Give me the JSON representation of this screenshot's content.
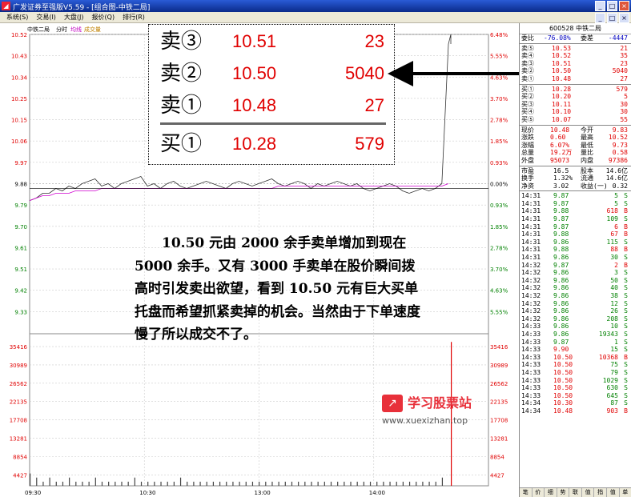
{
  "window": {
    "title": "广发证券至强版V5.59 - [组合图-中铁二局]",
    "icon_glyph": "◢",
    "buttons": [
      "_",
      "□",
      "×"
    ],
    "inner_buttons": [
      "_",
      "□",
      "×"
    ]
  },
  "menu": [
    "系统(S)",
    "交易(I)",
    "大盘(J)",
    "报价(Q)",
    "排行(R)"
  ],
  "chart_header": {
    "name": "中铁二局",
    "tab_minute": "分时",
    "tab_avg": "均线",
    "tab_vol": "成交量"
  },
  "chart_data": {
    "type": "line",
    "price_ticks": [
      "10.52",
      "10.43",
      "10.34",
      "10.25",
      "10.15",
      "10.06",
      "9.97",
      "9.88",
      "9.79",
      "9.70",
      "9.61",
      "9.51",
      "9.42",
      "9.33"
    ],
    "pct_ticks": [
      "6.48%",
      "5.55%",
      "4.63%",
      "3.70%",
      "2.78%",
      "1.85%",
      "0.93%",
      "0.00%",
      "0.93%",
      "1.85%",
      "2.78%",
      "3.70%",
      "4.63%",
      "5.55%"
    ],
    "volume_ticks": [
      "35416",
      "30989",
      "26562",
      "22135",
      "17708",
      "13281",
      "8854",
      "4427"
    ],
    "time_ticks": [
      "09:30",
      "10:30",
      "13:00",
      "14:00"
    ],
    "prev_close": 9.88,
    "ylim": [
      9.28,
      10.52
    ],
    "price_series": [
      9.83,
      9.84,
      9.86,
      9.86,
      9.88,
      9.87,
      9.89,
      9.88,
      9.9,
      9.91,
      9.92,
      9.89,
      9.9,
      9.88,
      9.9,
      9.91,
      9.92,
      9.93,
      9.89,
      9.9,
      9.88,
      9.9,
      9.91,
      9.89,
      9.88,
      9.89,
      9.9,
      9.91,
      9.9,
      9.89,
      9.88,
      9.9,
      9.91,
      9.9,
      9.89,
      9.9,
      9.91,
      9.92,
      9.9,
      9.89,
      9.9,
      9.91,
      9.9,
      9.88,
      9.9,
      9.89,
      9.9,
      9.91,
      9.9,
      9.89,
      9.9,
      9.88,
      9.87,
      9.88,
      9.89,
      9.9,
      9.89,
      9.87,
      9.86,
      9.87,
      9.88,
      9.87,
      9.88,
      9.9,
      10.48
    ],
    "avg_series": [
      9.83,
      9.84,
      9.85,
      9.85,
      9.86,
      9.86,
      9.86,
      9.87,
      9.87,
      9.87,
      9.87,
      9.88,
      9.88,
      9.88,
      9.88,
      9.88,
      9.88,
      9.88,
      9.88,
      9.88,
      9.88,
      9.88,
      9.88,
      9.88,
      9.88,
      9.88,
      9.88,
      9.88,
      9.88,
      9.88,
      9.88,
      9.88,
      9.88,
      9.88,
      9.88,
      9.88,
      9.88,
      9.88,
      9.89,
      9.89,
      9.89,
      9.89,
      9.89,
      9.89,
      9.89,
      9.89,
      9.89,
      9.89,
      9.89,
      9.89,
      9.89,
      9.89,
      9.89,
      9.89,
      9.89,
      9.89,
      9.89,
      9.89,
      9.89,
      9.89,
      9.89,
      9.89,
      9.89,
      9.89,
      9.9
    ],
    "volume_series": [
      3,
      2,
      1,
      2,
      1,
      1,
      2,
      1,
      1,
      1,
      2,
      1,
      1,
      1,
      1,
      1,
      2,
      1,
      1,
      1,
      1,
      1,
      1,
      2,
      1,
      1,
      1,
      1,
      1,
      1,
      1,
      1,
      1,
      1,
      1,
      1,
      1,
      1,
      1,
      1,
      1,
      1,
      1,
      1,
      1,
      1,
      1,
      1,
      1,
      1,
      1,
      1,
      1,
      1,
      1,
      1,
      1,
      1,
      1,
      1,
      1,
      1,
      1,
      2,
      35
    ],
    "volume_max": 37000
  },
  "zoom": {
    "rows": [
      {
        "label": "卖③",
        "price": "10.51",
        "vol": "23"
      },
      {
        "label": "卖②",
        "price": "10.50",
        "vol": "5040"
      },
      {
        "label": "卖①",
        "price": "10.48",
        "vol": "27"
      },
      {
        "label": "买①",
        "price": "10.28",
        "vol": "579"
      }
    ]
  },
  "annotation": {
    "text": "10.50 元由 2000 余手卖单增加到现在 5000 余手。又有 3000 手卖单在股价瞬间拨高时引发卖出欲望，看到 10.50 元有巨大买单托盘而希望抓紧卖掉的机会。当然由于下单速度慢了所以成交不了。"
  },
  "watermark": {
    "logo_glyph": "↗",
    "name": "学习股票站",
    "url": "www.xuexizhan.top"
  },
  "quote": {
    "title": "600528 中铁二局",
    "ratio_row": {
      "l1": "委比",
      "v1": "-76.08%",
      "l2": "委差",
      "v2": "-4447"
    },
    "asks": [
      {
        "label": "卖⑤",
        "price": "10.53",
        "vol": "21"
      },
      {
        "label": "卖④",
        "price": "10.52",
        "vol": "35"
      },
      {
        "label": "卖③",
        "price": "10.51",
        "vol": "23"
      },
      {
        "label": "卖②",
        "price": "10.50",
        "vol": "5040"
      },
      {
        "label": "卖①",
        "price": "10.48",
        "vol": "27"
      }
    ],
    "bids": [
      {
        "label": "买①",
        "price": "10.28",
        "vol": "579"
      },
      {
        "label": "买②",
        "price": "10.20",
        "vol": "5"
      },
      {
        "label": "买③",
        "price": "10.11",
        "vol": "30"
      },
      {
        "label": "买④",
        "price": "10.10",
        "vol": "30"
      },
      {
        "label": "买⑤",
        "price": "10.07",
        "vol": "55"
      }
    ],
    "stats": [
      {
        "l1": "现价",
        "v1": "10.48",
        "l2": "今开",
        "v2": "9.83"
      },
      {
        "l1": "涨跌",
        "v1": "0.60",
        "l2": "最高",
        "v2": "10.52"
      },
      {
        "l1": "涨幅",
        "v1": "6.07%",
        "l2": "最低",
        "v2": "9.73"
      },
      {
        "l1": "总量",
        "v1": "19.2万",
        "l2": "量比",
        "v2": "0.58"
      },
      {
        "l1": "外盘",
        "v1": "95073",
        "l2": "内盘",
        "v2": "97386"
      }
    ],
    "stats2": [
      {
        "l1": "市盈",
        "v1": "16.5",
        "l2": "股本",
        "v2": "14.6亿"
      },
      {
        "l1": "换手",
        "v1": "1.32%",
        "l2": "流通",
        "v2": "14.6亿"
      },
      {
        "l1": "净资",
        "v1": "3.02",
        "l2": "收益(一)",
        "v2": "0.32"
      }
    ],
    "ticks": [
      {
        "t": "14:31",
        "p": "9.87",
        "v": "5",
        "s": "S"
      },
      {
        "t": "14:31",
        "p": "9.87",
        "v": "5",
        "s": "S"
      },
      {
        "t": "14:31",
        "p": "9.88",
        "v": "618",
        "s": "B"
      },
      {
        "t": "14:31",
        "p": "9.87",
        "v": "109",
        "s": "S"
      },
      {
        "t": "14:31",
        "p": "9.87",
        "v": "6",
        "s": "B"
      },
      {
        "t": "14:31",
        "p": "9.88",
        "v": "67",
        "s": "B"
      },
      {
        "t": "14:31",
        "p": "9.86",
        "v": "115",
        "s": "S"
      },
      {
        "t": "14:31",
        "p": "9.88",
        "v": "88",
        "s": "B"
      },
      {
        "t": "14:31",
        "p": "9.86",
        "v": "30",
        "s": "S"
      },
      {
        "t": "14:32",
        "p": "9.87",
        "v": "2",
        "s": "B"
      },
      {
        "t": "14:32",
        "p": "9.86",
        "v": "3",
        "s": "S"
      },
      {
        "t": "14:32",
        "p": "9.86",
        "v": "50",
        "s": "S"
      },
      {
        "t": "14:32",
        "p": "9.86",
        "v": "40",
        "s": "S"
      },
      {
        "t": "14:32",
        "p": "9.86",
        "v": "38",
        "s": "S"
      },
      {
        "t": "14:32",
        "p": "9.86",
        "v": "12",
        "s": "S"
      },
      {
        "t": "14:32",
        "p": "9.86",
        "v": "26",
        "s": "S"
      },
      {
        "t": "14:32",
        "p": "9.86",
        "v": "208",
        "s": "S"
      },
      {
        "t": "14:33",
        "p": "9.86",
        "v": "10",
        "s": "S"
      },
      {
        "t": "14:33",
        "p": "9.86",
        "v": "19343",
        "s": "S"
      },
      {
        "t": "14:33",
        "p": "9.87",
        "v": "1",
        "s": "S"
      },
      {
        "t": "14:33",
        "p": "9.90",
        "v": "15",
        "s": "S"
      },
      {
        "t": "14:33",
        "p": "10.50",
        "v": "10368",
        "s": "B"
      },
      {
        "t": "14:33",
        "p": "10.50",
        "v": "75",
        "s": "S"
      },
      {
        "t": "14:33",
        "p": "10.50",
        "v": "79",
        "s": "S"
      },
      {
        "t": "14:33",
        "p": "10.50",
        "v": "1029",
        "s": "S"
      },
      {
        "t": "14:33",
        "p": "10.50",
        "v": "630",
        "s": "S"
      },
      {
        "t": "14:33",
        "p": "10.50",
        "v": "645",
        "s": "S"
      },
      {
        "t": "14:34",
        "p": "10.30",
        "v": "87",
        "s": "S"
      },
      {
        "t": "14:34",
        "p": "10.48",
        "v": "903",
        "s": "B"
      }
    ],
    "tabs": [
      "笔",
      "价",
      "细",
      "势",
      "联",
      "值",
      "指",
      "值",
      "单"
    ]
  }
}
